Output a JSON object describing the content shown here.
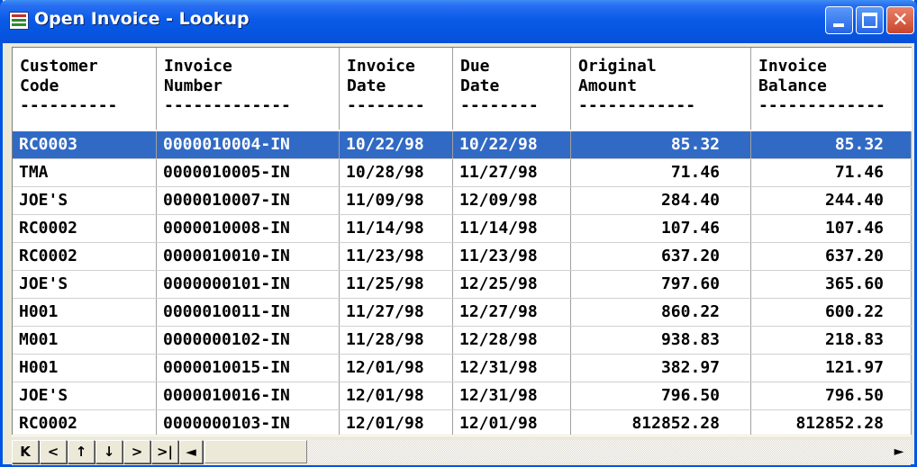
{
  "window": {
    "title": "Open Invoice - Lookup",
    "icon": "table-list-icon"
  },
  "title_buttons": {
    "minimize": "minimize-icon",
    "maximize": "maximize-icon",
    "close": "close-icon"
  },
  "columns": [
    {
      "line1": "Customer",
      "line2": "Code",
      "dashes": "----------"
    },
    {
      "line1": "Invoice",
      "line2": "Number",
      "dashes": "-------------"
    },
    {
      "line1": "Invoice",
      "line2": "Date",
      "dashes": "--------"
    },
    {
      "line1": "Due",
      "line2": "Date",
      "dashes": "--------"
    },
    {
      "line1": "Original",
      "line2": "Amount",
      "dashes": "------------"
    },
    {
      "line1": "Invoice",
      "line2": "Balance",
      "dashes": "-------------"
    }
  ],
  "rows": [
    {
      "code": "RC0003",
      "invoice": "0000010004-IN",
      "inv_date": "10/22/98",
      "due_date": "10/22/98",
      "original": "85.32",
      "balance": "85.32",
      "selected": true
    },
    {
      "code": "TMA",
      "invoice": "0000010005-IN",
      "inv_date": "10/28/98",
      "due_date": "11/27/98",
      "original": "71.46",
      "balance": "71.46"
    },
    {
      "code": "JOE'S",
      "invoice": "0000010007-IN",
      "inv_date": "11/09/98",
      "due_date": "12/09/98",
      "original": "284.40",
      "balance": "244.40"
    },
    {
      "code": "RC0002",
      "invoice": "0000010008-IN",
      "inv_date": "11/14/98",
      "due_date": "11/14/98",
      "original": "107.46",
      "balance": "107.46"
    },
    {
      "code": "RC0002",
      "invoice": "0000010010-IN",
      "inv_date": "11/23/98",
      "due_date": "11/23/98",
      "original": "637.20",
      "balance": "637.20"
    },
    {
      "code": "JOE'S",
      "invoice": "0000000101-IN",
      "inv_date": "11/25/98",
      "due_date": "12/25/98",
      "original": "797.60",
      "balance": "365.60"
    },
    {
      "code": "H001",
      "invoice": "0000010011-IN",
      "inv_date": "11/27/98",
      "due_date": "12/27/98",
      "original": "860.22",
      "balance": "600.22"
    },
    {
      "code": "M001",
      "invoice": "0000000102-IN",
      "inv_date": "11/28/98",
      "due_date": "12/28/98",
      "original": "938.83",
      "balance": "218.83"
    },
    {
      "code": "H001",
      "invoice": "0000010015-IN",
      "inv_date": "12/01/98",
      "due_date": "12/31/98",
      "original": "382.97",
      "balance": "121.97"
    },
    {
      "code": "JOE'S",
      "invoice": "0000010016-IN",
      "inv_date": "12/01/98",
      "due_date": "12/31/98",
      "original": "796.50",
      "balance": "796.50"
    },
    {
      "code": "RC0002",
      "invoice": "0000000103-IN",
      "inv_date": "12/01/98",
      "due_date": "12/01/98",
      "original": "812852.28",
      "balance": "812852.28"
    }
  ],
  "nav": {
    "first": {
      "glyph": "K",
      "icon": "first-record-icon"
    },
    "prev": {
      "glyph": "<",
      "icon": "previous-record-icon"
    },
    "page_up": {
      "glyph": "↑",
      "icon": "page-up-icon"
    },
    "page_down": {
      "glyph": "↓",
      "icon": "page-down-icon"
    },
    "next": {
      "glyph": ">",
      "icon": "next-record-icon"
    },
    "last": {
      "glyph": ">|",
      "icon": "last-record-icon"
    },
    "scroll_left": {
      "glyph": "◄",
      "icon": "scroll-left-icon"
    },
    "scroll_right": {
      "glyph": "►",
      "icon": "scroll-right-icon"
    }
  },
  "colors": {
    "title_blue": "#0a5be8",
    "selection": "#316ac5",
    "face": "#ece9d8"
  }
}
